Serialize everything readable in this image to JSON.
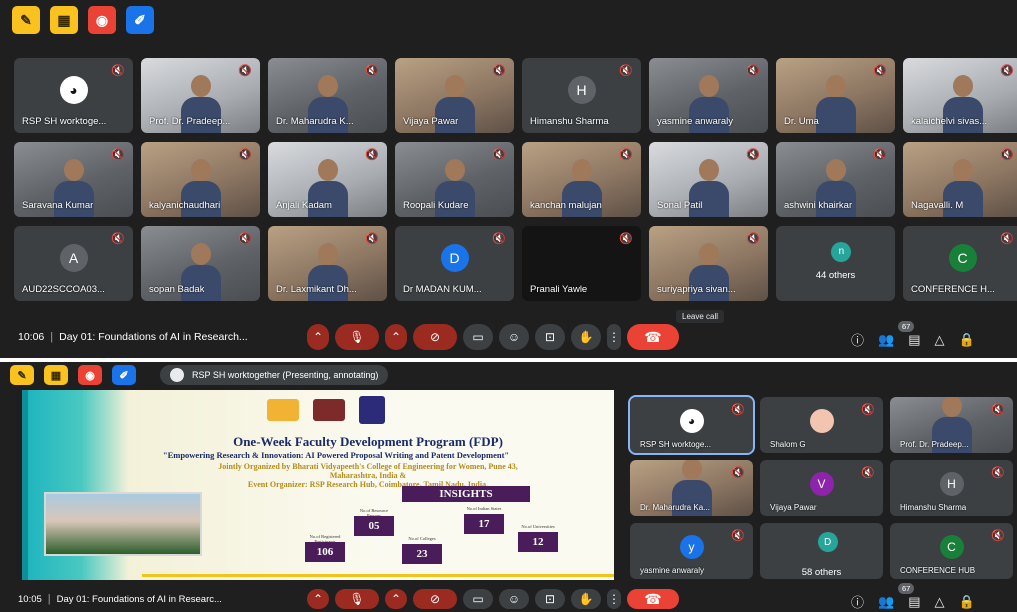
{
  "top": {
    "toolbar_icons": [
      "marker-icon",
      "frame-icon",
      "record-icon",
      "annotate-icon"
    ],
    "tiles": [
      {
        "name": "RSP SH worktoge...",
        "kind": "logo"
      },
      {
        "name": "Prof. Dr. Pradeep...",
        "kind": "video"
      },
      {
        "name": "Dr. Maharudra K...",
        "kind": "video"
      },
      {
        "name": "Vijaya Pawar",
        "kind": "video"
      },
      {
        "name": "Himanshu Sharma",
        "kind": "avatar",
        "initial": "H",
        "color": "#5f6368"
      },
      {
        "name": "yasmine anwaraly",
        "kind": "video"
      },
      {
        "name": "Dr. Uma",
        "kind": "video"
      },
      {
        "name": "kalaichelvi sivas...",
        "kind": "video"
      },
      {
        "name": "Saravana Kumar",
        "kind": "video"
      },
      {
        "name": "kalyanichaudhari",
        "kind": "video"
      },
      {
        "name": "Anjali Kadam",
        "kind": "video"
      },
      {
        "name": "Roopali Kudare",
        "kind": "video"
      },
      {
        "name": "kanchan malujan",
        "kind": "video"
      },
      {
        "name": "Sonal Patil",
        "kind": "video"
      },
      {
        "name": "ashwini khairkar",
        "kind": "video"
      },
      {
        "name": "Nagavalli. M",
        "kind": "video"
      },
      {
        "name": "AUD22SCCOA03...",
        "kind": "avatar",
        "initial": "A",
        "color": "#5f6368"
      },
      {
        "name": "sopan Badak",
        "kind": "video"
      },
      {
        "name": "Dr. Laxmikant Dh...",
        "kind": "video"
      },
      {
        "name": "Dr MADAN KUM...",
        "kind": "avatar",
        "initial": "D",
        "color": "#1a73e8"
      },
      {
        "name": "Pranali Yawle",
        "kind": "dark"
      },
      {
        "name": "suriyapriya sivan...",
        "kind": "video"
      },
      {
        "name": "44 others",
        "kind": "others",
        "initial": "n"
      },
      {
        "name": "CONFERENCE H...",
        "kind": "avatar",
        "initial": "C",
        "color": "#188038"
      }
    ],
    "bar": {
      "time": "10:06",
      "meeting": "Day 01: Foundations of AI in Research...",
      "tooltip": "Leave call",
      "participants_count": "67"
    }
  },
  "bottom": {
    "presenter": "RSP SH worktogether (Presenting, annotating)",
    "slide": {
      "title": "One-Week Faculty Development Program (FDP)",
      "subtitle": "\"Empowering Research & Innovation: AI Powered Proposal Writing and Patent Development\"",
      "organized_line1": "Jointly Organized by Bharati Vidyapeeth's College of Engineering for Women, Pune 43,",
      "organized_line2": "Maharashtra, India &",
      "organized_line3": "Event Organizer: RSP Research Hub, Coimbatore, Tamil Nadu, India.",
      "insights_label": "INSIGHTS",
      "stats": [
        {
          "value": "106",
          "label": "No.of Registered Participants"
        },
        {
          "value": "05",
          "label": "No.of Resource Persons"
        },
        {
          "value": "23",
          "label": "No.of Colleges"
        },
        {
          "value": "17",
          "label": "No.of Indian States"
        },
        {
          "value": "12",
          "label": "No.of Universities"
        }
      ]
    },
    "side_tiles": [
      {
        "name": "RSP SH worktoge...",
        "kind": "logo",
        "active": true
      },
      {
        "name": "Shalom G",
        "kind": "avatar",
        "initial": "",
        "color": "#f3c5b0"
      },
      {
        "name": "Prof. Dr. Pradeep...",
        "kind": "video"
      },
      {
        "name": "Dr. Maharudra Ka...",
        "kind": "video"
      },
      {
        "name": "Vijaya Pawar",
        "kind": "avatar",
        "initial": "V",
        "color": "#8e24aa"
      },
      {
        "name": "Himanshu Sharma",
        "kind": "avatar",
        "initial": "H",
        "color": "#5f6368"
      },
      {
        "name": "yasmine anwaraly",
        "kind": "avatar",
        "initial": "y",
        "color": "#1a73e8"
      },
      {
        "name": "58 others",
        "kind": "others",
        "initial": "D"
      },
      {
        "name": "CONFERENCE HUB",
        "kind": "avatar",
        "initial": "C",
        "color": "#188038"
      }
    ],
    "bar": {
      "time": "10:05",
      "meeting": "Day 01: Foundations of AI in Researc...",
      "participants_count": "67"
    }
  }
}
